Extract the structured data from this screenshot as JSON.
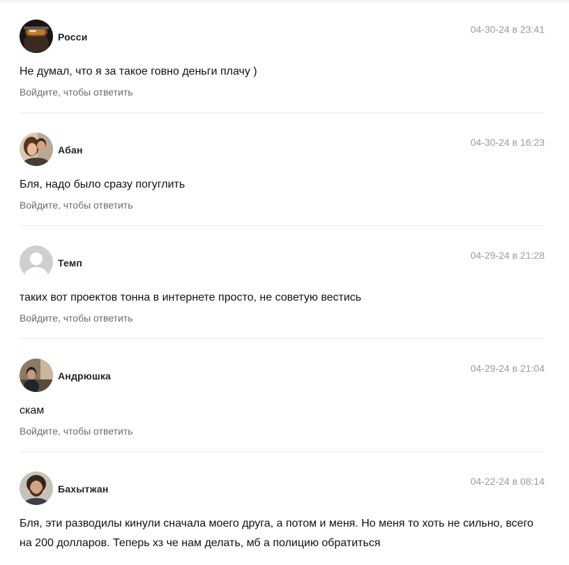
{
  "comments": [
    {
      "author": "Росси",
      "date": "04-30-24 в 23:41",
      "text": "Не думал, что я за такое говно деньги плачу )",
      "reply": "Войдите, чтобы ответить"
    },
    {
      "author": "Абан",
      "date": "04-30-24 в 16:23",
      "text": "Бля, надо было сразу погуглить",
      "reply": "Войдите, чтобы ответить"
    },
    {
      "author": "Темп",
      "date": "04-29-24 в 21:28",
      "text": "таких вот проектов тонна в интернете просто, не советую вестись",
      "reply": "Войдите, чтобы ответить"
    },
    {
      "author": "Андрюшка",
      "date": "04-29-24 в 21:04",
      "text": "скам",
      "reply": "Войдите, чтобы ответить"
    },
    {
      "author": "Бахытжан",
      "date": "04-22-24 в 08:14",
      "text": "Бля, эти разводилы кинули сначала моего друга, а потом и меня. Но меня то хоть не сильно, всего на 200 долларов. Теперь хз че нам делать, мб а полицию обратиться"
    }
  ]
}
